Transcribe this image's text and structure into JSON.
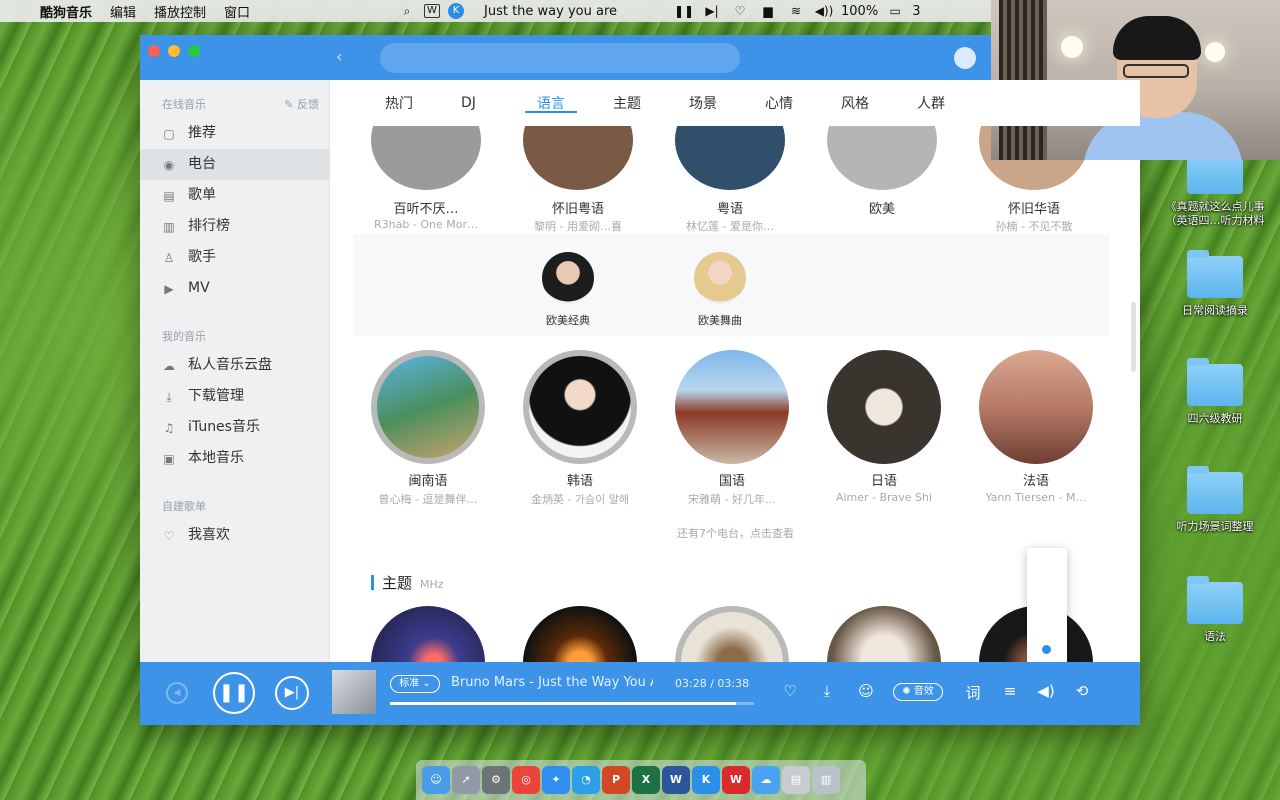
{
  "menubar": {
    "apple": "",
    "app_name": "酷狗音乐",
    "menus": [
      "编辑",
      "播放控制",
      "窗口"
    ],
    "now_playing": "Just the way you are",
    "battery": "100%",
    "clock_partial": "3"
  },
  "window": {
    "tabs": [
      "热门",
      "DJ",
      "语言",
      "主题",
      "场景",
      "心情",
      "风格",
      "人群"
    ],
    "active_tab": "语言",
    "sidebar": {
      "online_section": "在线音乐",
      "feedback": "反馈",
      "online_items": [
        {
          "label": "推荐",
          "icon": "recommend-icon"
        },
        {
          "label": "电台",
          "icon": "radio-icon"
        },
        {
          "label": "歌单",
          "icon": "playlist-icon"
        },
        {
          "label": "排行榜",
          "icon": "chart-icon"
        },
        {
          "label": "歌手",
          "icon": "singer-icon"
        },
        {
          "label": "MV",
          "icon": "mv-icon"
        }
      ],
      "active_item": "电台",
      "my_section": "我的音乐",
      "my_items": [
        {
          "label": "私人音乐云盘",
          "icon": "cloud-icon"
        },
        {
          "label": "下载管理",
          "icon": "download-icon"
        },
        {
          "label": "iTunes音乐",
          "icon": "itunes-icon"
        },
        {
          "label": "本地音乐",
          "icon": "local-music-icon"
        }
      ],
      "created_section": "自建歌单",
      "created_items": [
        {
          "label": "我喜欢",
          "icon": "heart-icon"
        }
      ]
    },
    "top_row": [
      {
        "name": "百听不厌…",
        "sub": "R3hab - One Mor…"
      },
      {
        "name": "怀旧粤语",
        "sub": "黎明 - 用爱砌…喜"
      },
      {
        "name": "粤语",
        "sub": "林忆莲 - 爱是你…"
      },
      {
        "name": "欧美",
        "sub": ""
      },
      {
        "name": "怀旧华语",
        "sub": "孙楠 - 不见不散"
      }
    ],
    "expanded_items": [
      {
        "name": "欧美经典"
      },
      {
        "name": "欧美舞曲"
      }
    ],
    "language_row": [
      {
        "name": "闽南语",
        "sub": "曾心梅 - 逗是舞伴…"
      },
      {
        "name": "韩语",
        "sub": "金炳英 - 가슴이 말해"
      },
      {
        "name": "国语",
        "sub": "宋雅萌 - 好几年…"
      },
      {
        "name": "日语",
        "sub": "Aimer - Brave Shi"
      },
      {
        "name": "法语",
        "sub": "Yann Tiersen - M…"
      }
    ],
    "more_link": "还有7个电台，点击查看",
    "theme_section": {
      "title": "主题",
      "sub": "MHz"
    }
  },
  "player": {
    "tag": "标准",
    "song": "Bruno Mars - Just the Way You Are",
    "time": "03:28 / 03:38",
    "progress": 0.95,
    "sound_effect": "音效",
    "lyrics_button": "词",
    "volume_level": 0.05
  },
  "desktop_icons": [
    {
      "label": "《真题就这么点儿事（英语四…听力材料"
    },
    {
      "label": "日常阅读摘录"
    },
    {
      "label": "四六级教研"
    },
    {
      "label": "听力场景词整理"
    },
    {
      "label": "语法"
    }
  ],
  "dock": [
    "finder-icon",
    "launchpad-icon",
    "system-preferences-icon",
    "chrome-icon",
    "safari-icon",
    "qq-icon",
    "powerpoint-icon",
    "excel-icon",
    "word-icon",
    "kugou-icon",
    "wps-icon",
    "cloud-drive-icon",
    "preview-icon",
    "trash-icon"
  ],
  "colors": {
    "accent": "#3d93e8",
    "heart": "#f05b5b"
  }
}
